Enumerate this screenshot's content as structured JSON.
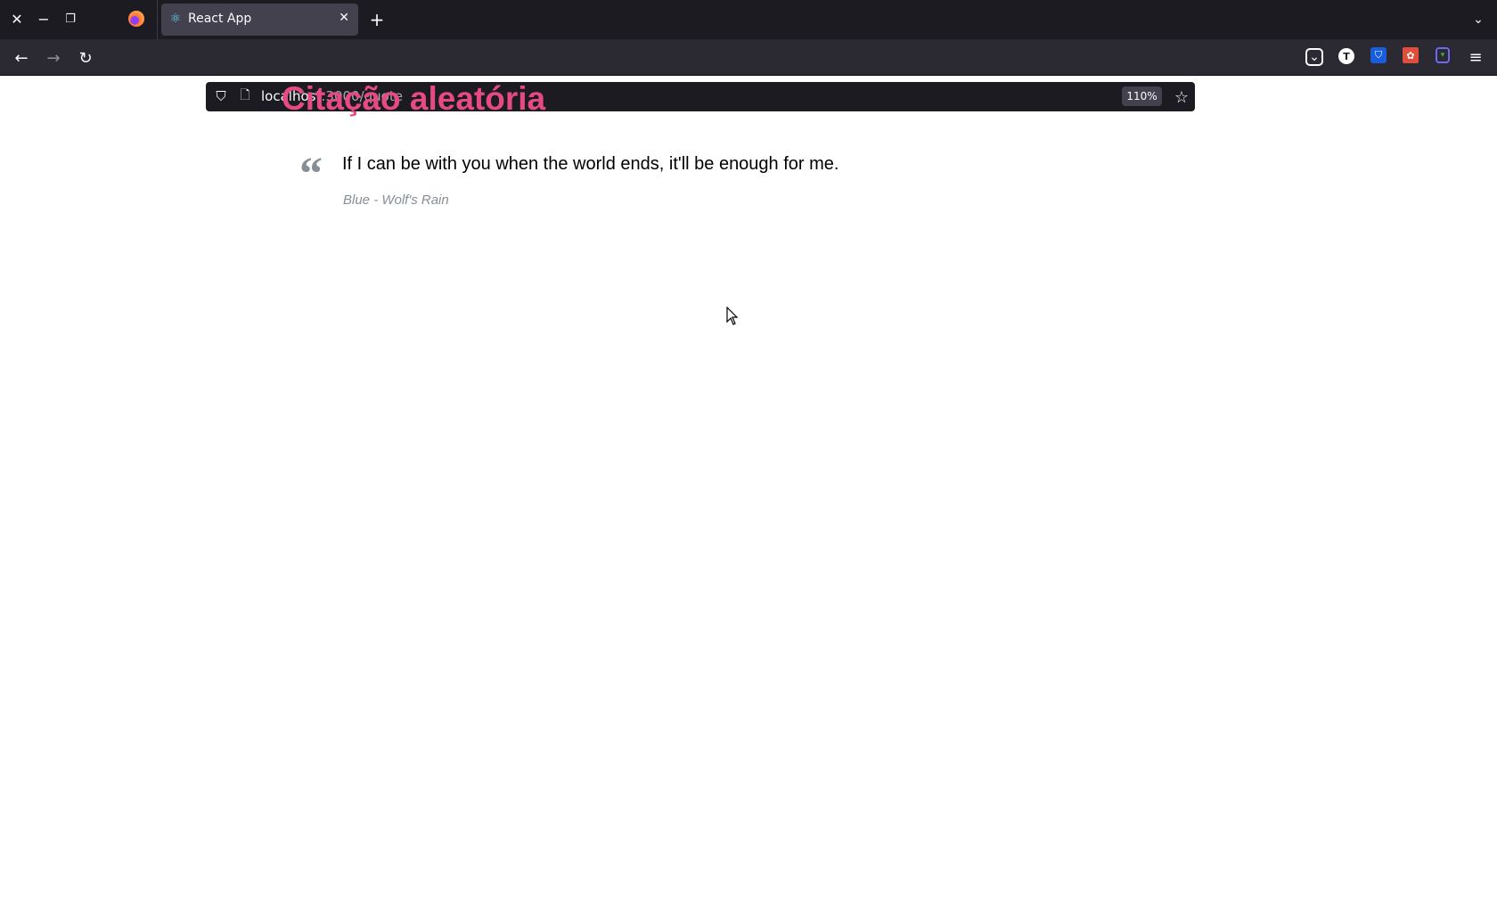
{
  "browser": {
    "tab_title": "React App",
    "url_host": "localhost",
    "url_path": ":3000/quote",
    "zoom_level": "110%",
    "icons": [
      "close-window-icon",
      "minimize-icon",
      "restore-icon",
      "firefox-icon",
      "react-favicon",
      "tab-close-icon",
      "new-tab-icon",
      "back-icon",
      "forward-icon",
      "reload-icon",
      "shield-icon",
      "page-icon",
      "star-icon",
      "pocket-icon",
      "extension-t-icon",
      "bitwarden-icon",
      "extension-red-icon",
      "extension-purple-icon",
      "menu-icon"
    ]
  },
  "page": {
    "title": "Citação aleatória",
    "quote_text": "If I can be with you when the world ends, it'll be enough for me.",
    "quote_author": "Blue - Wolf's Rain",
    "title_color": "#e54b80"
  }
}
